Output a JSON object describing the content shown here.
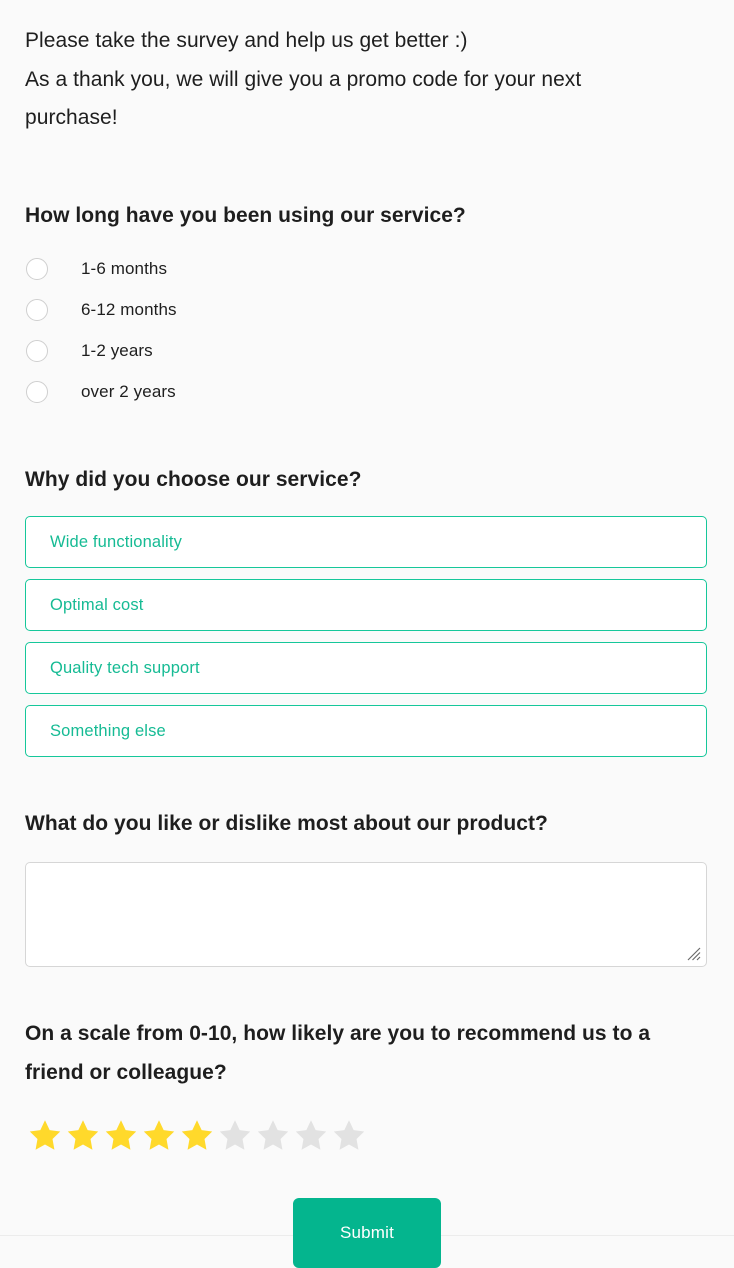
{
  "intro": {
    "line1": "Please take the survey and help us get better :)",
    "line2": "As a thank you, we will give you a promo code for your next purchase!"
  },
  "questions": {
    "service_length": {
      "label": "How long have you been using our service?",
      "options": [
        "1-6 months",
        "6-12 months",
        "1-2 years",
        "over 2 years"
      ],
      "selected": null
    },
    "choose_reason": {
      "label": "Why did you choose our service?",
      "options": [
        "Wide functionality",
        "Optimal cost",
        "Quality tech support",
        "Something else"
      ]
    },
    "free_text": {
      "label": "What do you like or dislike most about our product?",
      "value": "",
      "placeholder": ""
    },
    "recommend": {
      "label": "On a scale from 0-10, how likely are you to recommend us to a friend or colleague?",
      "stars_total": 9,
      "stars_filled": 5
    }
  },
  "actions": {
    "submit_label": "Submit"
  },
  "colors": {
    "accent_teal": "#16c79a",
    "submit_teal": "#04b58e",
    "star_filled": "#ffd92b",
    "star_empty": "#e2e2e2",
    "background": "#fafafa",
    "text": "#1e1e1e"
  }
}
